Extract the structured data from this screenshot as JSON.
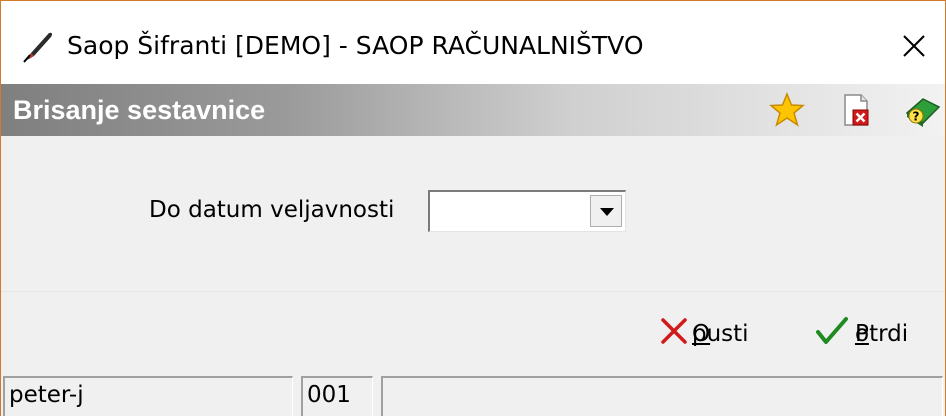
{
  "window": {
    "title": "Saop Šifranti [DEMO] - SAOP RAČUNALNIŠTVO",
    "close_glyph": "✕"
  },
  "header": {
    "title": "Brisanje sestavnice",
    "icons": [
      "star-icon",
      "delete-document-icon",
      "help-book-icon"
    ]
  },
  "form": {
    "field_label": "Do datum veljavnosti",
    "field_value": ""
  },
  "buttons": {
    "cancel": {
      "accel": "O",
      "rest": "pusti"
    },
    "confirm": {
      "accel": "P",
      "rest": "otrdi"
    }
  },
  "status": {
    "user": "peter-j",
    "company": "001",
    "info": ""
  },
  "colors": {
    "window_border": "#d07a2a",
    "cancel_icon": "#d11a1a",
    "confirm_icon": "#1f8a1f",
    "header_text": "#ffffff"
  }
}
